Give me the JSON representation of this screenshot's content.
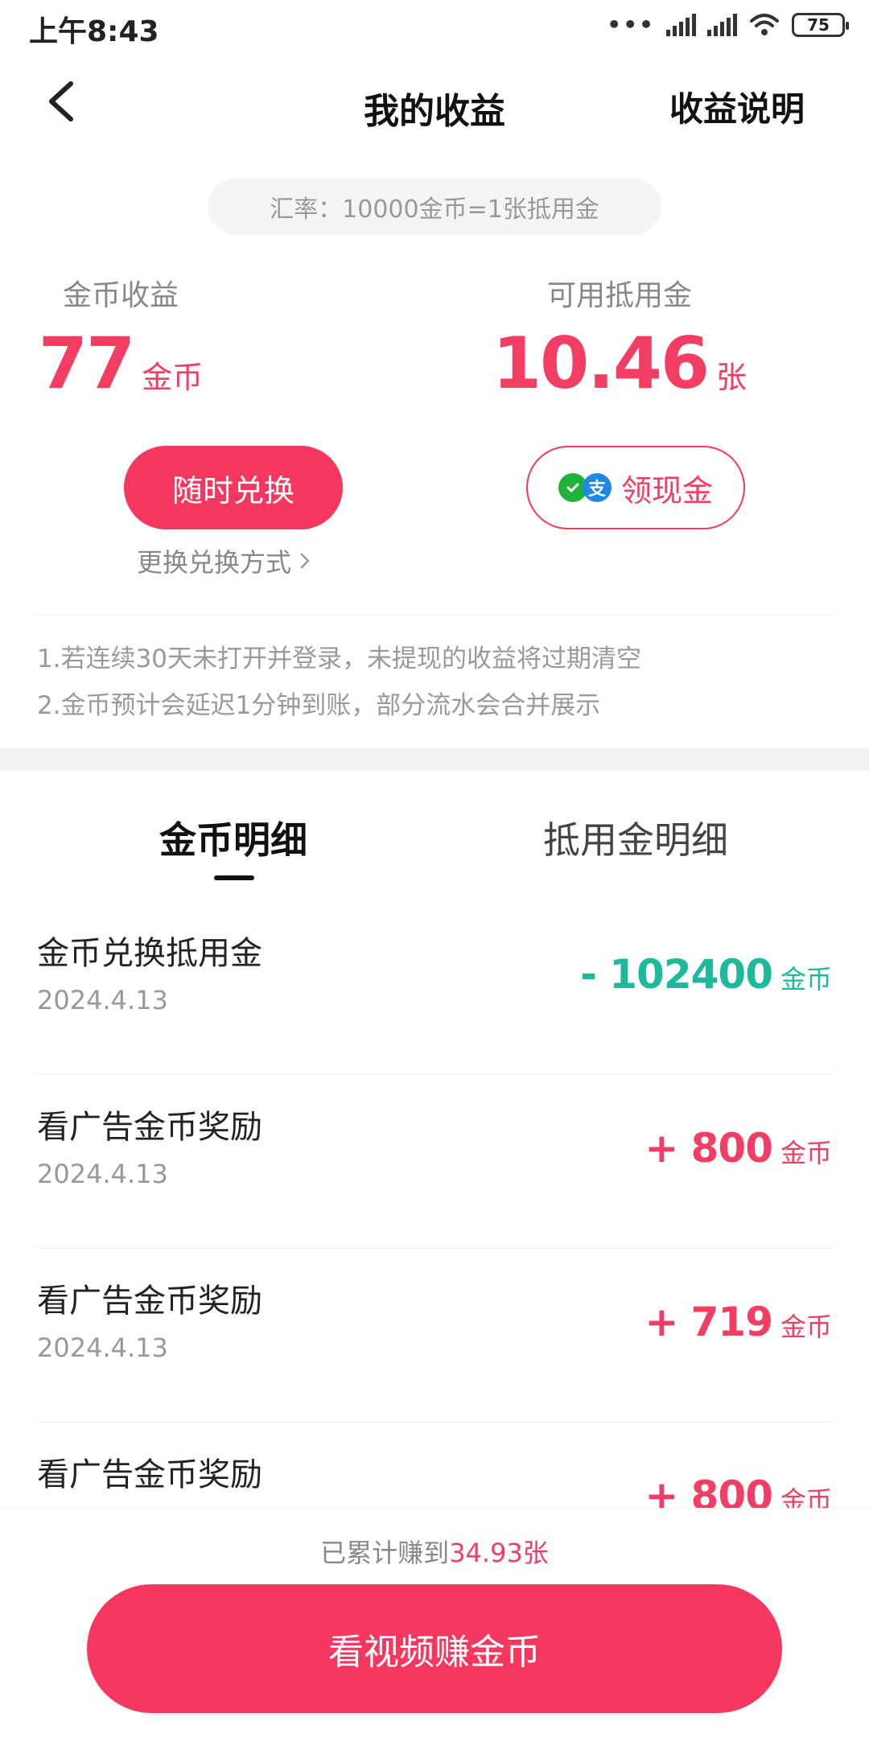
{
  "status_bar": {
    "time": "上午8:43",
    "battery": "75"
  },
  "header": {
    "title": "我的收益",
    "explain_link": "收益说明"
  },
  "rate": "汇率：10000金币=1张抵用金",
  "stats": {
    "coins": {
      "label": "金币收益",
      "value": "77",
      "unit": "金币"
    },
    "voucher": {
      "label": "可用抵用金",
      "value": "10.46",
      "unit": "张"
    }
  },
  "actions": {
    "exchange_label": "随时兑换",
    "change_method": "更换兑换方式",
    "cash_label": "领现金"
  },
  "notes": [
    "1.若连续30天未打开并登录，未提现的收益将过期清空",
    "2.金币预计会延迟1分钟到账，部分流水会合并展示"
  ],
  "tabs": [
    {
      "label": "金币明细"
    },
    {
      "label": "抵用金明细"
    }
  ],
  "records": [
    {
      "title": "金币兑换抵用金",
      "date": "2024.4.13",
      "amount": "- 102400",
      "unit": "金币"
    },
    {
      "title": "看广告金币奖励",
      "date": "2024.4.13",
      "amount": "+ 800",
      "unit": "金币"
    },
    {
      "title": "看广告金币奖励",
      "date": "2024.4.13",
      "amount": "+ 719",
      "unit": "金币"
    },
    {
      "title": "看广告金币奖励",
      "date": "",
      "amount": "+ 800",
      "unit": "金币"
    }
  ],
  "footer": {
    "total_prefix": "已累计赚到",
    "total_value": "34.93张",
    "watch_button": "看视频赚金币"
  },
  "colors": {
    "accent": "#f6375f",
    "negative": "#1cb99a"
  }
}
